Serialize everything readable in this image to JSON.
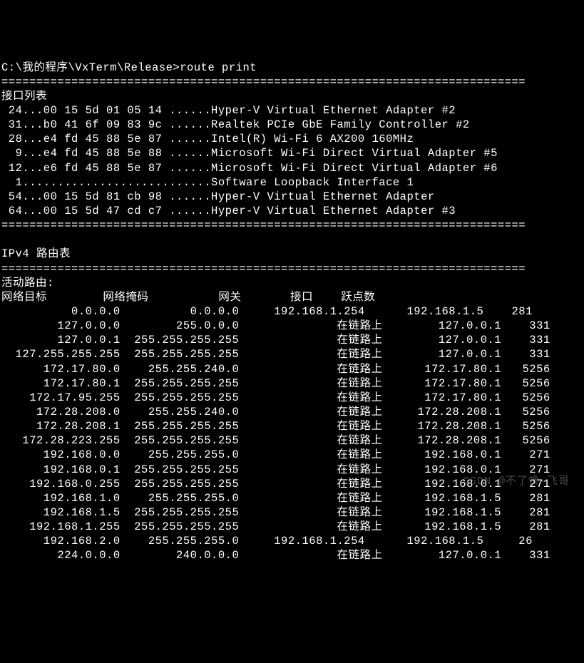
{
  "prompt": {
    "path": "C:\\我的程序\\VxTerm\\Release>",
    "command": "route print"
  },
  "divider": "===========================================================================",
  "interfaceHeader": "接口列表",
  "interfaces": [
    {
      "idx": "24",
      "mac": "00 15 5d 01 05 14",
      "dots": "......",
      "name": "Hyper-V Virtual Ethernet Adapter #2"
    },
    {
      "idx": "31",
      "mac": "b0 41 6f 09 83 9c",
      "dots": "......",
      "name": "Realtek PCIe GbE Family Controller #2"
    },
    {
      "idx": "28",
      "mac": "e4 fd 45 88 5e 87",
      "dots": "......",
      "name": "Intel(R) Wi-Fi 6 AX200 160MHz"
    },
    {
      "idx": " 9",
      "mac": "e4 fd 45 88 5e 88",
      "dots": "......",
      "name": "Microsoft Wi-Fi Direct Virtual Adapter #5"
    },
    {
      "idx": "12",
      "mac": "e6 fd 45 88 5e 87",
      "dots": "......",
      "name": "Microsoft Wi-Fi Direct Virtual Adapter #6"
    },
    {
      "idx": " 1",
      "mac": "",
      "dots": "...........................",
      "name": "Software Loopback Interface 1"
    },
    {
      "idx": "54",
      "mac": "00 15 5d 81 cb 98",
      "dots": "......",
      "name": "Hyper-V Virtual Ethernet Adapter"
    },
    {
      "idx": "64",
      "mac": "00 15 5d 47 cd c7",
      "dots": "......",
      "name": "Hyper-V Virtual Ethernet Adapter #3"
    }
  ],
  "ipv4Header": "IPv4 路由表",
  "activeRoutes": "活动路由:",
  "columns": {
    "dest": "网络目标",
    "mask": "网络掩码",
    "gateway": "网关",
    "iface": "接口",
    "metric": "跃点数"
  },
  "routes": [
    {
      "dest": "0.0.0.0",
      "mask": "0.0.0.0",
      "gateway": "192.168.1.254",
      "iface": "192.168.1.5",
      "metric": "281"
    },
    {
      "dest": "127.0.0.0",
      "mask": "255.0.0.0",
      "gateway": "在链路上",
      "iface": "127.0.0.1",
      "metric": "331"
    },
    {
      "dest": "127.0.0.1",
      "mask": "255.255.255.255",
      "gateway": "在链路上",
      "iface": "127.0.0.1",
      "metric": "331"
    },
    {
      "dest": "127.255.255.255",
      "mask": "255.255.255.255",
      "gateway": "在链路上",
      "iface": "127.0.0.1",
      "metric": "331"
    },
    {
      "dest": "172.17.80.0",
      "mask": "255.255.240.0",
      "gateway": "在链路上",
      "iface": "172.17.80.1",
      "metric": "5256"
    },
    {
      "dest": "172.17.80.1",
      "mask": "255.255.255.255",
      "gateway": "在链路上",
      "iface": "172.17.80.1",
      "metric": "5256"
    },
    {
      "dest": "172.17.95.255",
      "mask": "255.255.255.255",
      "gateway": "在链路上",
      "iface": "172.17.80.1",
      "metric": "5256"
    },
    {
      "dest": "172.28.208.0",
      "mask": "255.255.240.0",
      "gateway": "在链路上",
      "iface": "172.28.208.1",
      "metric": "5256"
    },
    {
      "dest": "172.28.208.1",
      "mask": "255.255.255.255",
      "gateway": "在链路上",
      "iface": "172.28.208.1",
      "metric": "5256"
    },
    {
      "dest": "172.28.223.255",
      "mask": "255.255.255.255",
      "gateway": "在链路上",
      "iface": "172.28.208.1",
      "metric": "5256"
    },
    {
      "dest": "192.168.0.0",
      "mask": "255.255.255.0",
      "gateway": "在链路上",
      "iface": "192.168.0.1",
      "metric": "271"
    },
    {
      "dest": "192.168.0.1",
      "mask": "255.255.255.255",
      "gateway": "在链路上",
      "iface": "192.168.0.1",
      "metric": "271"
    },
    {
      "dest": "192.168.0.255",
      "mask": "255.255.255.255",
      "gateway": "在链路上",
      "iface": "192.168.0.1",
      "metric": "271"
    },
    {
      "dest": "192.168.1.0",
      "mask": "255.255.255.0",
      "gateway": "在链路上",
      "iface": "192.168.1.5",
      "metric": "281"
    },
    {
      "dest": "192.168.1.5",
      "mask": "255.255.255.255",
      "gateway": "在链路上",
      "iface": "192.168.1.5",
      "metric": "281"
    },
    {
      "dest": "192.168.1.255",
      "mask": "255.255.255.255",
      "gateway": "在链路上",
      "iface": "192.168.1.5",
      "metric": "281"
    },
    {
      "dest": "192.168.2.0",
      "mask": "255.255.255.0",
      "gateway": "192.168.1.254",
      "iface": "192.168.1.5",
      "metric": "26"
    },
    {
      "dest": "224.0.0.0",
      "mask": "240.0.0.0",
      "gateway": "在链路上",
      "iface": "127.0.0.1",
      "metric": "331"
    }
  ],
  "watermark": "CSDN @不了馋-飞哥"
}
